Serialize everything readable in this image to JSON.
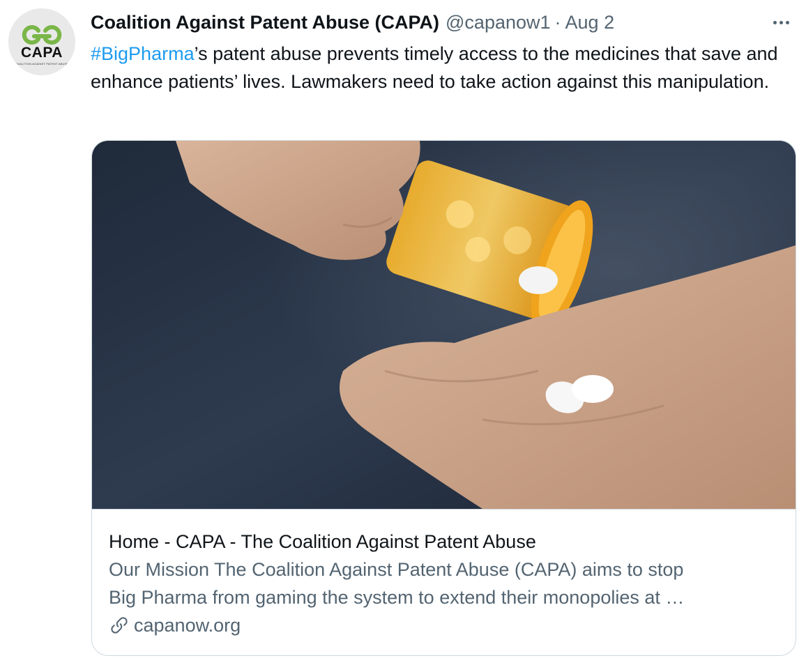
{
  "tweet": {
    "author_name": "Coalition Against Patent Abuse (CAPA)",
    "handle": "@capanow1",
    "separator": "·",
    "date": "Aug 2",
    "hashtag": "#BigPharma",
    "text_after_hashtag": "’s patent abuse prevents timely access to the medicines that save and enhance patients’ lives. Lawmakers need to take action against this manipulation."
  },
  "avatar": {
    "logo_text": "CAPA",
    "logo_subtext": "COALITION AGAINST PATENT ABUSE",
    "accent_color": "#7ab648"
  },
  "card": {
    "title": "Home - CAPA - The Coalition Against Patent Abuse",
    "description_line1": "Our Mission The Coalition Against Patent Abuse (CAPA) aims to stop",
    "description_line2": "Big Pharma from gaming the system to extend their monopolies at …",
    "domain": "capanow.org",
    "link_icon": "link-icon"
  },
  "icons": {
    "more": "more-options-icon"
  },
  "colors": {
    "link_blue": "#1d9bf0",
    "muted_gray": "#536471",
    "text": "#0f1419",
    "border": "#cfd9de"
  }
}
